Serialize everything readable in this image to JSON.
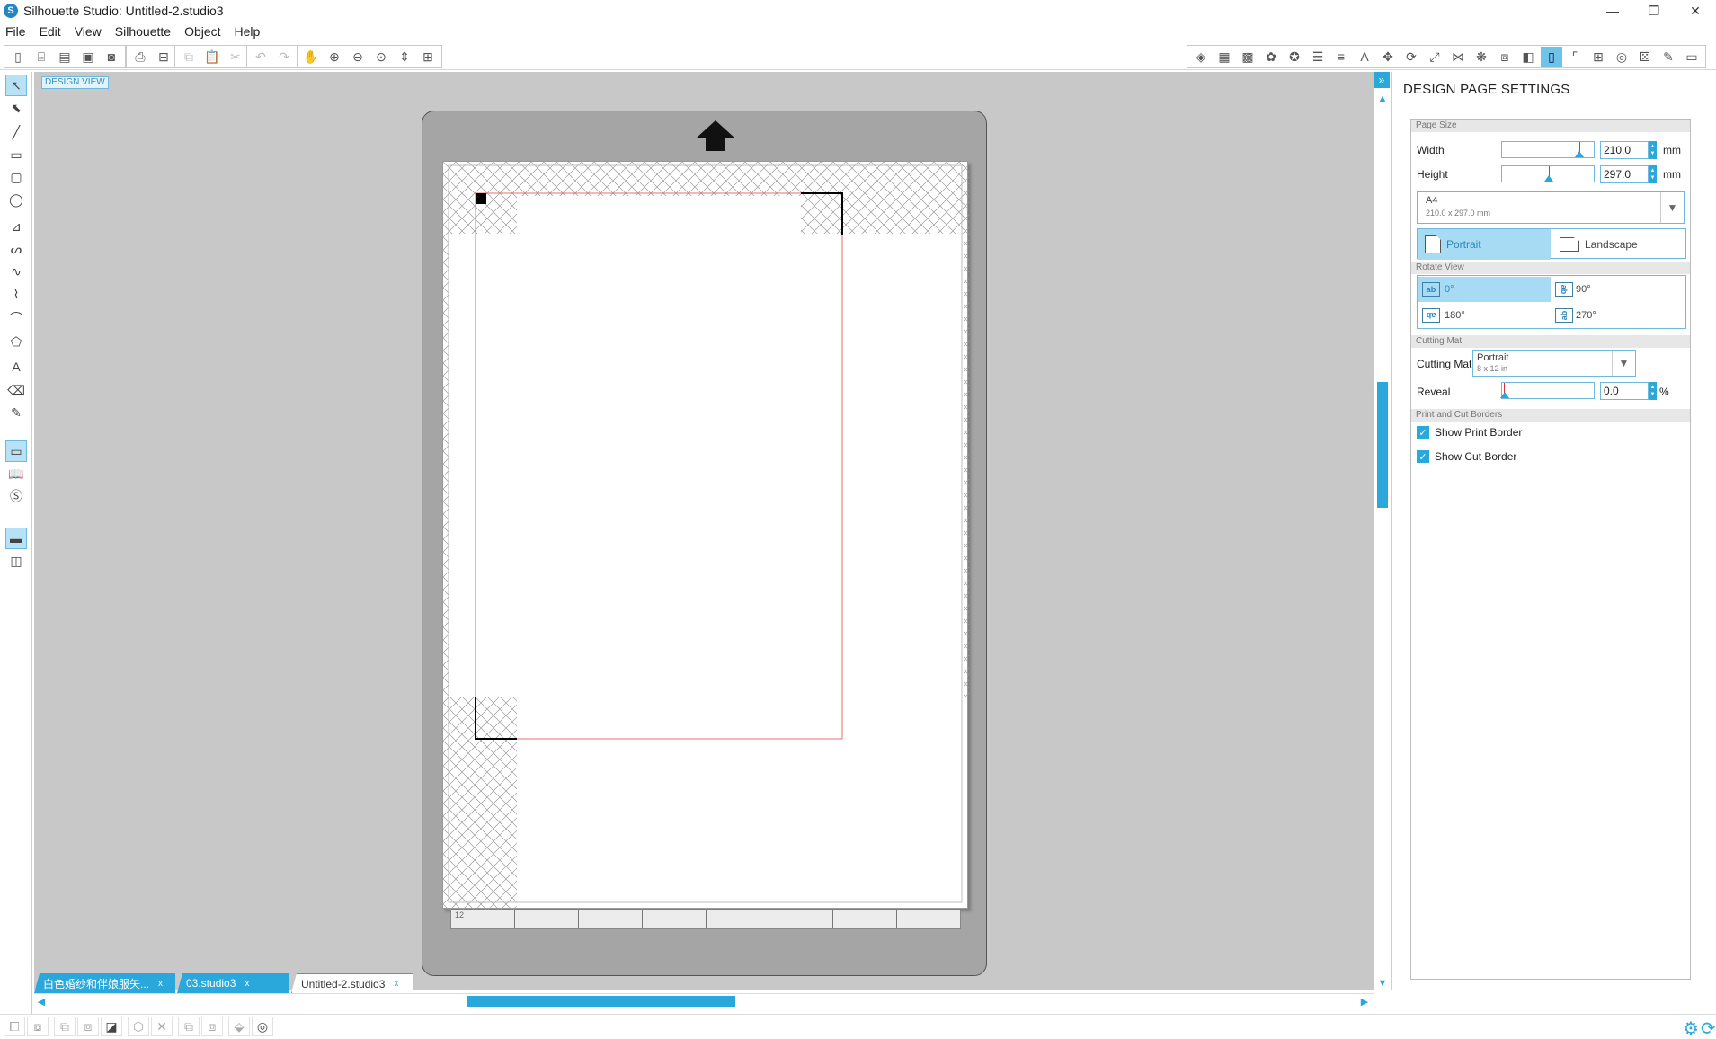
{
  "window": {
    "title": "Silhouette Studio: Untitled-2.studio3",
    "logo_glyph": "S",
    "controls": [
      "—",
      "❐",
      "✕"
    ]
  },
  "menu": [
    "File",
    "Edit",
    "View",
    "Silhouette",
    "Object",
    "Help"
  ],
  "canvas": {
    "view_label": "DESIGN VIEW",
    "ruler_label": "12"
  },
  "tabs": [
    {
      "label": "白色婚纱和伴娘服矢...",
      "close": "x"
    },
    {
      "label": "03.studio3",
      "close": "x"
    },
    {
      "label": "Untitled-2.studio3",
      "close": "x"
    }
  ],
  "panel": {
    "toggle": "»",
    "title": "DESIGN PAGE SETTINGS",
    "page_size": {
      "section": "Page Size",
      "width_label": "Width",
      "width_value": "210.0",
      "height_label": "Height",
      "height_value": "297.0",
      "unit": "mm",
      "preset_name": "A4",
      "preset_size": "210.0 x 297.0 mm",
      "portrait": "Portrait",
      "landscape": "Landscape",
      "orientation_selected": "Portrait"
    },
    "rotate_view": {
      "section": "Rotate View",
      "options": [
        "0°",
        "90°",
        "180°",
        "270°"
      ],
      "selected": "0°",
      "icon_text": "ab"
    },
    "cutting_mat": {
      "section": "Cutting Mat",
      "label": "Cutting Mat",
      "value": "Portrait",
      "size": "8 x 12 in",
      "reveal_label": "Reveal",
      "reveal_value": "0.0",
      "reveal_unit": "%"
    },
    "borders": {
      "section": "Print and Cut Borders",
      "show_print": "Show Print Border",
      "show_print_checked": true,
      "show_cut": "Show Cut Border",
      "show_cut_checked": true
    }
  },
  "colors": {
    "accent": "#2aa8dc",
    "selected_bg": "#a7dbf3",
    "canvas_bg": "#c8c8c8",
    "mat_bg": "#a5a5a5",
    "cut_border": "#e86c6c"
  }
}
